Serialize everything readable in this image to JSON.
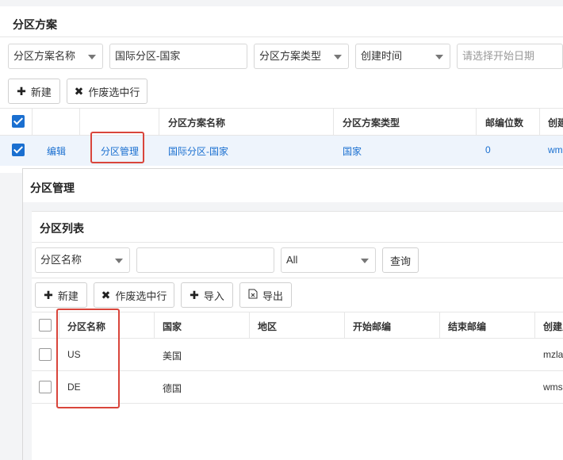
{
  "scheme": {
    "title": "分区方案",
    "filters": {
      "scheme_name_select": "分区方案名称",
      "scheme_name_value": "国际分区-国家",
      "scheme_type_select": "分区方案类型",
      "created_time_select": "创建时间",
      "start_date_placeholder": "请选择开始日期"
    },
    "toolbar": {
      "new_label": "新建",
      "void_label": "作废选中行"
    },
    "table": {
      "headers": [
        "分区方案名称",
        "分区方案类型",
        "邮编位数",
        "创建"
      ],
      "row": {
        "edit": "编辑",
        "manage": "分区管理",
        "name": "国际分区-国家",
        "type": "国家",
        "digits": "0",
        "creator": "wm"
      }
    }
  },
  "dialog": {
    "title": "分区管理",
    "list": {
      "title": "分区列表",
      "filters": {
        "name_select": "分区名称",
        "name_value": "",
        "scope_select": "All",
        "query_label": "查询"
      },
      "toolbar": {
        "new_label": "新建",
        "void_label": "作废选中行",
        "import_label": "导入",
        "export_label": "导出"
      },
      "headers": [
        "分区名称",
        "国家",
        "地区",
        "开始邮编",
        "结束邮编",
        "创建人"
      ],
      "rows": [
        {
          "name": "US",
          "country": "美国",
          "region": "",
          "start": "",
          "end": "",
          "creator": "mzla"
        },
        {
          "name": "DE",
          "country": "德国",
          "region": "",
          "start": "",
          "end": "",
          "creator": "wms"
        }
      ]
    }
  },
  "colors": {
    "accent": "#1a6fd0",
    "highlight": "#d9453b"
  }
}
